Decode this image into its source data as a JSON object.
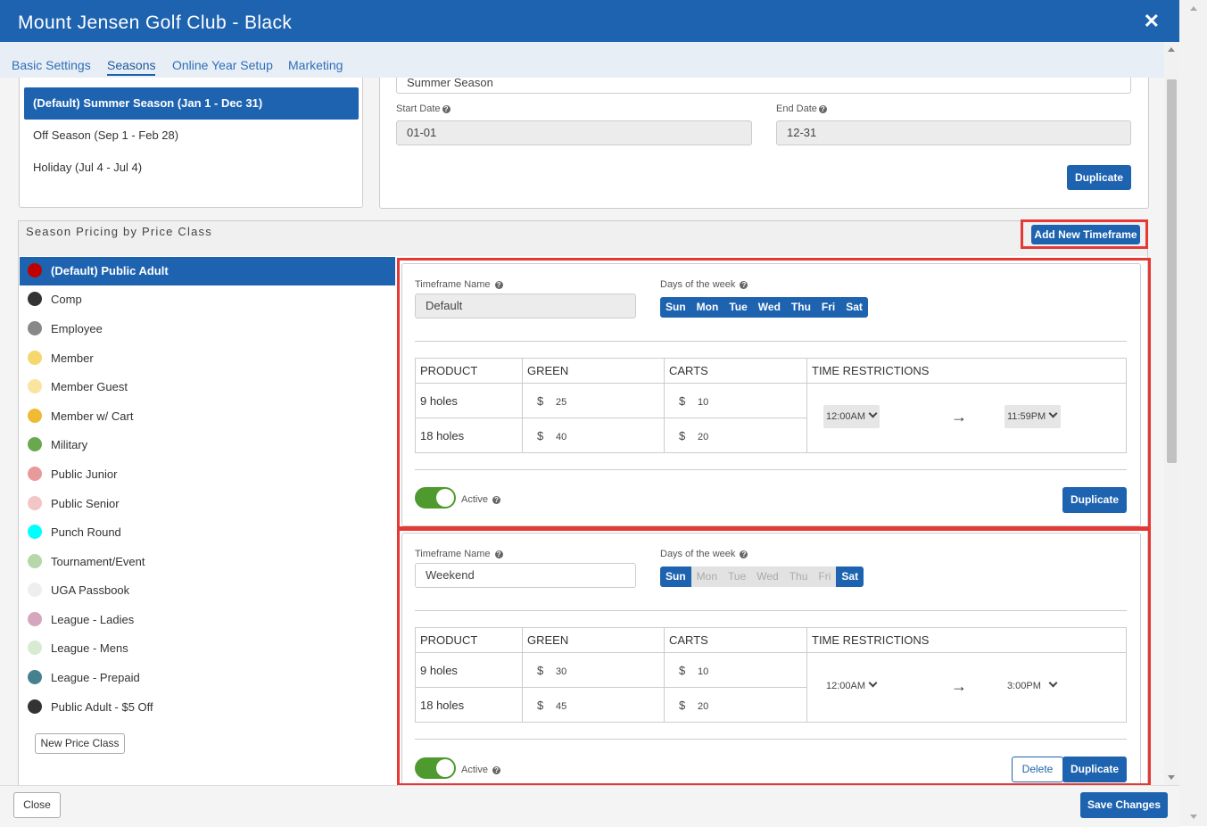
{
  "header": {
    "title": "Mount Jensen Golf Club - Black",
    "close_glyph": "✕"
  },
  "tabs": [
    {
      "label": "Basic Settings"
    },
    {
      "label": "Seasons"
    },
    {
      "label": "Online Year Setup"
    },
    {
      "label": "Marketing"
    }
  ],
  "active_tab": "Seasons",
  "seasons": [
    {
      "label": "(Default) Summer Season (Jan 1 - Dec 31)",
      "active": true
    },
    {
      "label": "Off Season (Sep 1 - Feb 28)"
    },
    {
      "label": "Holiday (Jul 4 - Jul 4)"
    }
  ],
  "season_form": {
    "name_value": "Summer Season",
    "start_label": "Start Date",
    "start_value": "01-01",
    "end_label": "End Date",
    "end_value": "12-31",
    "duplicate_label": "Duplicate"
  },
  "pricing": {
    "section_title": "Season Pricing by Price Class",
    "add_timeframe_label": "Add New Timeframe",
    "price_classes": [
      {
        "label": "(Default) Public Adult",
        "color": "#c00000",
        "active": true
      },
      {
        "label": "Comp",
        "color": "#333333"
      },
      {
        "label": "Employee",
        "color": "#888888"
      },
      {
        "label": "Member",
        "color": "#f5d76e"
      },
      {
        "label": "Member Guest",
        "color": "#fbe3a0"
      },
      {
        "label": "Member w/ Cart",
        "color": "#eebb33"
      },
      {
        "label": "Military",
        "color": "#6aa84f"
      },
      {
        "label": "Public Junior",
        "color": "#e89999"
      },
      {
        "label": "Public Senior",
        "color": "#f2c6c6"
      },
      {
        "label": "Punch Round",
        "color": "#00ffff"
      },
      {
        "label": "Tournament/Event",
        "color": "#b6d7a8"
      },
      {
        "label": "UGA Passbook",
        "color": "#eeeeee"
      },
      {
        "label": "League - Ladies",
        "color": "#d5a6bd"
      },
      {
        "label": "League - Mens",
        "color": "#d9ead3"
      },
      {
        "label": "League - Prepaid",
        "color": "#45818e"
      },
      {
        "label": "Public Adult - $5 Off",
        "color": "#333333"
      }
    ],
    "new_price_class_label": "New Price Class"
  },
  "table_headers": {
    "product": "PRODUCT",
    "green": "GREEN",
    "carts": "CARTS",
    "time": "TIME RESTRICTIONS"
  },
  "labels": {
    "timeframe_name": "Timeframe Name",
    "days_of_week": "Days of the week",
    "active": "Active",
    "duplicate": "Duplicate",
    "delete": "Delete",
    "currency": "$",
    "arrow": "→"
  },
  "timeframes": [
    {
      "name": "Default",
      "days": [
        {
          "label": "Sun",
          "on": true
        },
        {
          "label": "Mon",
          "on": true
        },
        {
          "label": "Tue",
          "on": true
        },
        {
          "label": "Wed",
          "on": true
        },
        {
          "label": "Thu",
          "on": true
        },
        {
          "label": "Fri",
          "on": true
        },
        {
          "label": "Sat",
          "on": true
        }
      ],
      "rows": [
        {
          "product": "9 holes",
          "green": "25",
          "carts": "10"
        },
        {
          "product": "18 holes",
          "green": "40",
          "carts": "20"
        }
      ],
      "time_start": "12:00AM",
      "time_end": "11:59PM",
      "active": true
    },
    {
      "name": "Weekend",
      "days": [
        {
          "label": "Sun",
          "on": true
        },
        {
          "label": "Mon",
          "on": false
        },
        {
          "label": "Tue",
          "on": false
        },
        {
          "label": "Wed",
          "on": false
        },
        {
          "label": "Thu",
          "on": false
        },
        {
          "label": "Fri",
          "on": false
        },
        {
          "label": "Sat",
          "on": true
        }
      ],
      "rows": [
        {
          "product": "9 holes",
          "green": "30",
          "carts": "10"
        },
        {
          "product": "18 holes",
          "green": "45",
          "carts": "20"
        }
      ],
      "time_start": "12:00AM",
      "time_end": "3:00PM",
      "active": true
    }
  ],
  "footer": {
    "close_label": "Close",
    "save_label": "Save Changes"
  },
  "colors": {
    "brand_blue": "#1e63b0",
    "highlight_red": "#e53935",
    "toggle_green": "#4e9a2e"
  }
}
